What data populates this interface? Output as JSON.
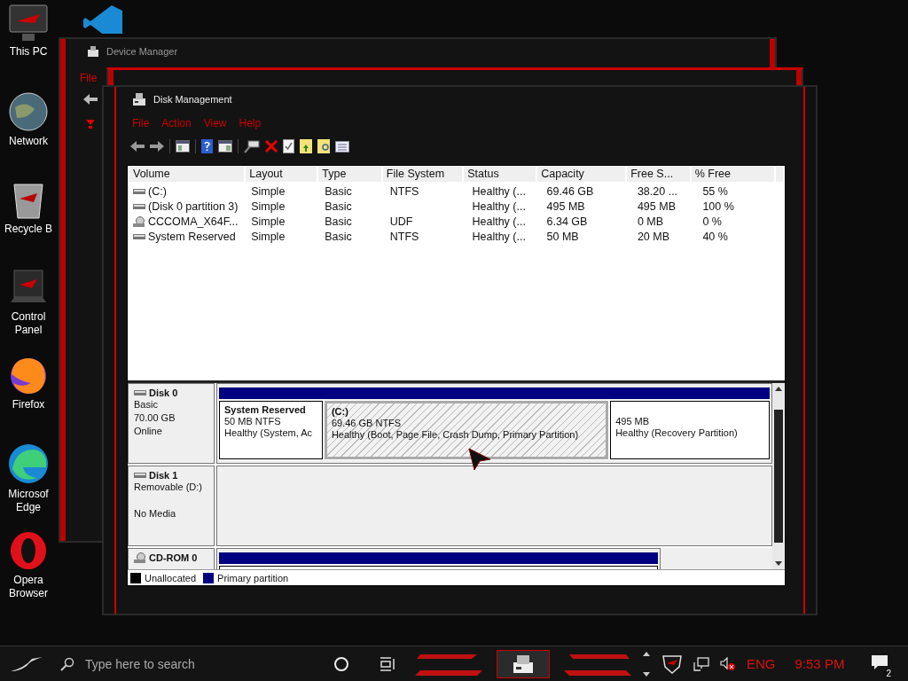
{
  "desktop_icons": [
    {
      "label": "This PC",
      "kind": "pc"
    },
    {
      "label": "Network",
      "kind": "globe"
    },
    {
      "label": "Recycle B",
      "kind": "bin"
    },
    {
      "label": "Control Panel",
      "kind": "panel"
    },
    {
      "label": "Firefox",
      "kind": "fox"
    },
    {
      "label": "Microsof Edge",
      "kind": "edge"
    },
    {
      "label": "Opera Browser",
      "kind": "opera"
    }
  ],
  "back_window": {
    "title": "Device Manager",
    "menu": [
      "File"
    ]
  },
  "window": {
    "title": "Disk Management",
    "menu": [
      "File",
      "Action",
      "View",
      "Help"
    ],
    "table": {
      "columns": [
        "Volume",
        "Layout",
        "Type",
        "File System",
        "Status",
        "Capacity",
        "Free S...",
        "% Free"
      ],
      "rows": [
        {
          "kind": "disk",
          "cells": [
            "(C:)",
            "Simple",
            "Basic",
            "NTFS",
            "Healthy (...",
            "69.46 GB",
            "38.20 ...",
            "55 %"
          ]
        },
        {
          "kind": "disk",
          "cells": [
            "(Disk 0 partition 3)",
            "Simple",
            "Basic",
            null,
            "Healthy (...",
            "495 MB",
            "495 MB",
            "100 %"
          ]
        },
        {
          "kind": "cdrom",
          "cells": [
            "CCCOMA_X64F...",
            "Simple",
            "Basic",
            "UDF",
            "Healthy (...",
            "6.34 GB",
            "0 MB",
            "0 %"
          ]
        },
        {
          "kind": "disk",
          "cells": [
            "System Reserved",
            "Simple",
            "Basic",
            "NTFS",
            "Healthy (...",
            "50 MB",
            "20 MB",
            "40 %"
          ]
        }
      ]
    },
    "disks": [
      {
        "kind": "disk",
        "name": "Disk 0",
        "type": "Basic",
        "size": "70.00 GB",
        "status": "Online",
        "partitions": [
          {
            "title": "System Reserved",
            "size": "50 MB NTFS",
            "status": "Healthy (System, Ac",
            "selected": false
          },
          {
            "title": "(C:)",
            "size": "69.46 GB NTFS",
            "status": "Healthy (Boot, Page File, Crash Dump, Primary Partition)",
            "selected": true
          },
          {
            "size": "495 MB",
            "status": "Healthy (Recovery Partition)",
            "selected": false
          }
        ]
      },
      {
        "kind": "disk",
        "name": "Disk 1",
        "type": "Removable (D:)",
        "status": "No Media"
      },
      {
        "kind": "cdrom",
        "name": "CD-ROM 0",
        "partitions": [
          {
            "selected": false
          }
        ]
      }
    ],
    "legend": [
      {
        "label": "Unallocated",
        "color": "#000000"
      },
      {
        "label": "Primary partition",
        "color": "#000080"
      }
    ]
  },
  "taskbar": {
    "search": {
      "placeholder": "Type here to search"
    },
    "language": "ENG",
    "time": "9:53 PM",
    "notifications": "2"
  }
}
